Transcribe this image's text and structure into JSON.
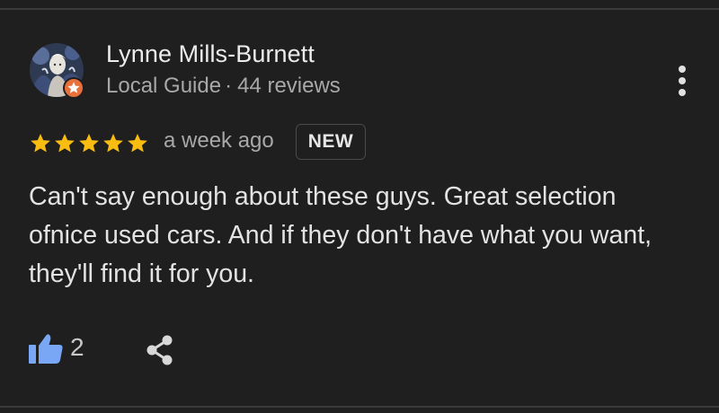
{
  "reviewer": {
    "name": "Lynne Mills-Burnett",
    "badge": "Local Guide",
    "separator": "·",
    "review_count": "44 reviews"
  },
  "rating": {
    "stars": 5,
    "max": 5,
    "time_ago": "a week ago",
    "new_label": "NEW"
  },
  "review": {
    "lines": [
      "Can't say enough about these guys. Great selection",
      "ofnice used cars. And if they don't have what you want,",
      "they'll find it for you."
    ]
  },
  "actions": {
    "like_count": "2",
    "like_icon": "thumbs-up-icon",
    "share_icon": "share-icon",
    "more_icon": "more-vert-icon"
  },
  "colors": {
    "background": "#1f1f1f",
    "star": "#f9bd12",
    "like_accent": "#7aa7f5",
    "guide_badge": "#e8703a"
  }
}
